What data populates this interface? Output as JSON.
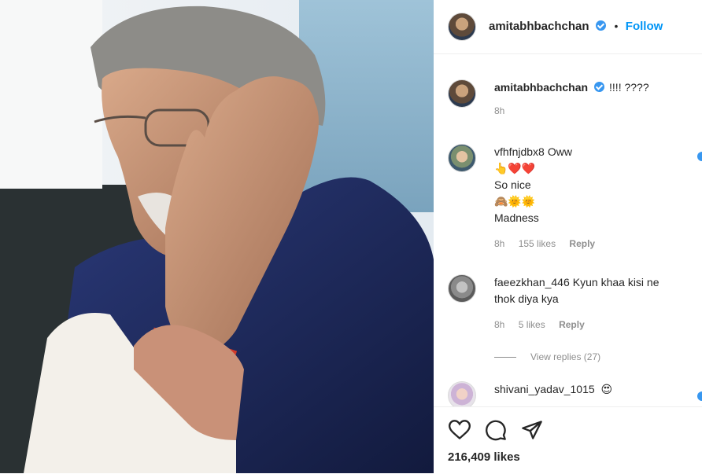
{
  "post": {
    "author": "amitabhbachchan",
    "follow_label": "Follow",
    "dot": "•",
    "likes": "216,409 likes",
    "photo_icon": "post-photo"
  },
  "caption": {
    "username": "amitabhbachchan",
    "text": "!!!! ????",
    "time": "8h"
  },
  "comments": [
    {
      "username": "vfhfnjdbx8",
      "lines": [
        "Oww",
        "👆❤️❤️",
        "So nice",
        "🙈🌞🌞",
        "Madness"
      ],
      "time": "8h",
      "likes": "155 likes",
      "reply": "Reply"
    },
    {
      "username": "faeezkhan_446",
      "lines": [
        "Kyun khaa kisi ne",
        "thok diya kya"
      ],
      "time": "8h",
      "likes": "5 likes",
      "reply": "Reply",
      "view_replies": "View replies (27)"
    },
    {
      "username": "shivani_yadav_1015",
      "lines": [
        "😍"
      ]
    }
  ],
  "actions": {
    "like_icon": "heart-icon",
    "comment_icon": "comment-icon",
    "share_icon": "share-icon"
  },
  "colors": {
    "accent": "#0095f6",
    "verified": "#3897f0",
    "muted": "#8e8e8e"
  }
}
